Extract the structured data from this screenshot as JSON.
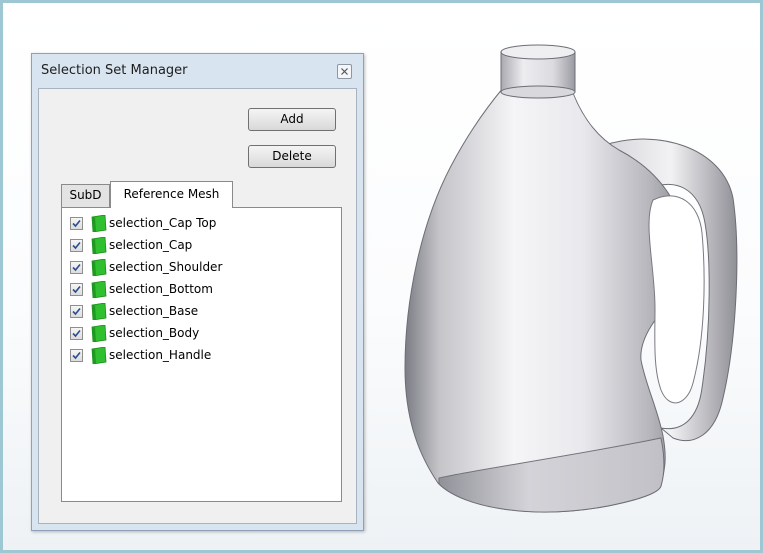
{
  "panel": {
    "title": "Selection Set Manager",
    "buttons": {
      "add": "Add",
      "delete": "Delete"
    },
    "tabs": [
      {
        "label": "SubD",
        "active": false
      },
      {
        "label": "Reference Mesh",
        "active": true
      }
    ],
    "items": [
      {
        "label": "selection_Cap Top",
        "checked": true
      },
      {
        "label": "selection_Cap",
        "checked": true
      },
      {
        "label": "selection_Shoulder",
        "checked": true
      },
      {
        "label": "selection_Bottom",
        "checked": true
      },
      {
        "label": "selection_Base",
        "checked": true
      },
      {
        "label": "selection_Body",
        "checked": true
      },
      {
        "label": "selection_Handle",
        "checked": true
      }
    ]
  },
  "colors": {
    "frame_border": "#9cc7d3",
    "selection_icon": "#2fbf2f",
    "checkmark": "#2a4f8f"
  },
  "icons": [
    "close-icon",
    "checkbox-icon",
    "selection-set-icon"
  ]
}
